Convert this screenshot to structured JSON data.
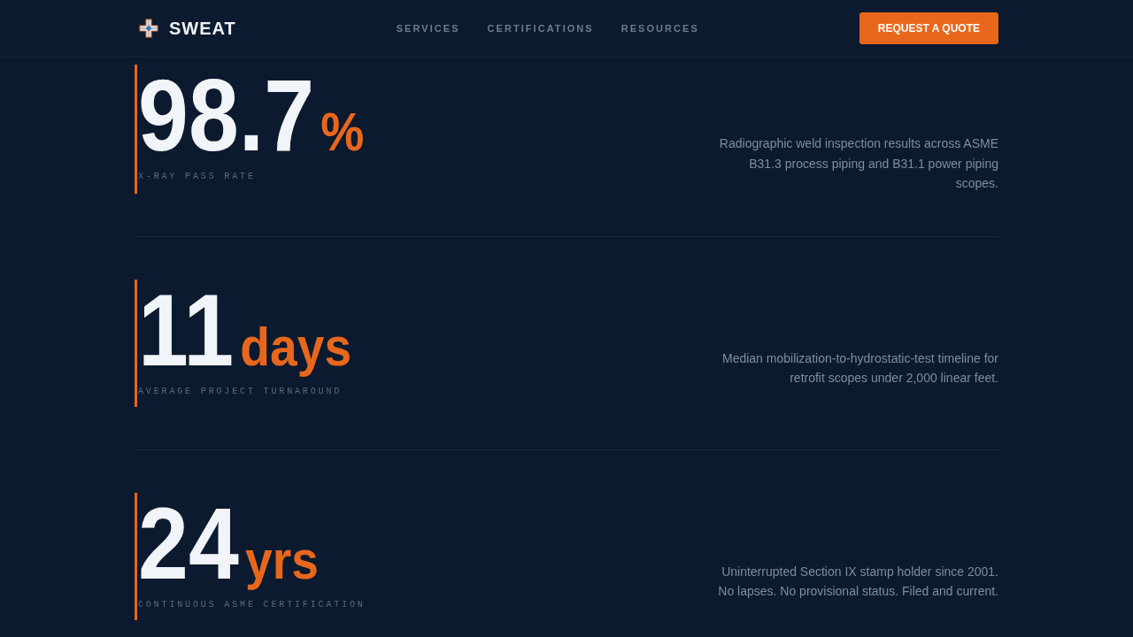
{
  "header": {
    "brand": "SWEAT",
    "nav": [
      "SERVICES",
      "CERTIFICATIONS",
      "RESOURCES"
    ],
    "cta": "REQUEST A QUOTE"
  },
  "stats": [
    {
      "value": "98.7",
      "unit": "%",
      "label": "X-RAY PASS RATE",
      "description": "Radiographic weld inspection results across ASME B31.3 process piping and B31.1 power piping scopes."
    },
    {
      "value": "11",
      "unit": "days",
      "label": "AVERAGE PROJECT TURNAROUND",
      "description": "Median mobilization-to-hydrostatic-test timeline for retrofit scopes under 2,000 linear feet."
    },
    {
      "value": "24",
      "unit": "yrs",
      "label": "CONTINUOUS ASME CERTIFICATION",
      "description": "Uninterrupted Section IX stamp holder since 2001. No lapses. No provisional status. Filed and current."
    }
  ]
}
